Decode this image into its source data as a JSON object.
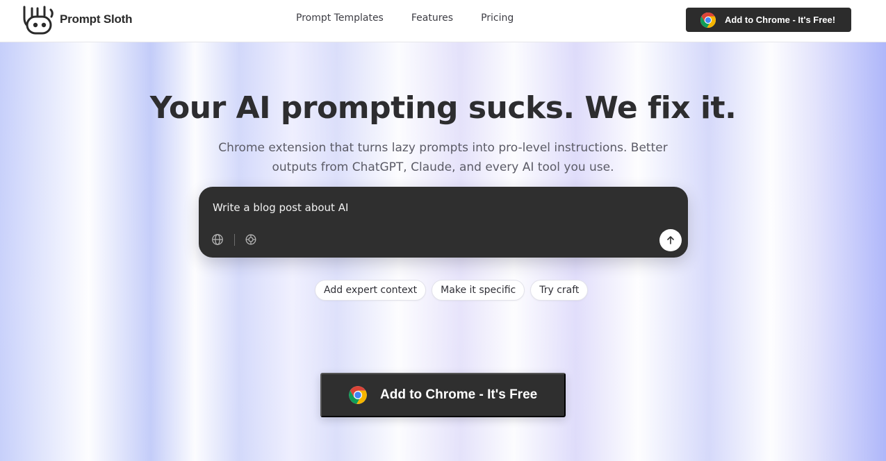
{
  "nav": {
    "logo_text": "Prompt Sloth",
    "links": [
      "Prompt Templates",
      "Features",
      "Pricing"
    ],
    "cta_label": "Add to Chrome - It's Free!"
  },
  "hero": {
    "headline": "Your AI prompting sucks. We fix it.",
    "subhead": "Chrome extension that turns lazy prompts into pro-level instructions. Better outputs from ChatGPT, Claude, and every AI tool you use."
  },
  "prompt": {
    "text": "Write a blog post about AI",
    "tools": [
      "globe-icon",
      "gear-icon"
    ],
    "send_icon": "arrow-up-icon"
  },
  "chips": [
    "Add expert context",
    "Make it specific",
    "Try craft"
  ],
  "cta": {
    "label": "Add to Chrome - It's Free"
  },
  "colors": {
    "dark": "#2f2f2f",
    "text": "#2d2d2f",
    "muted": "#5b5b66",
    "white": "#ffffff"
  }
}
